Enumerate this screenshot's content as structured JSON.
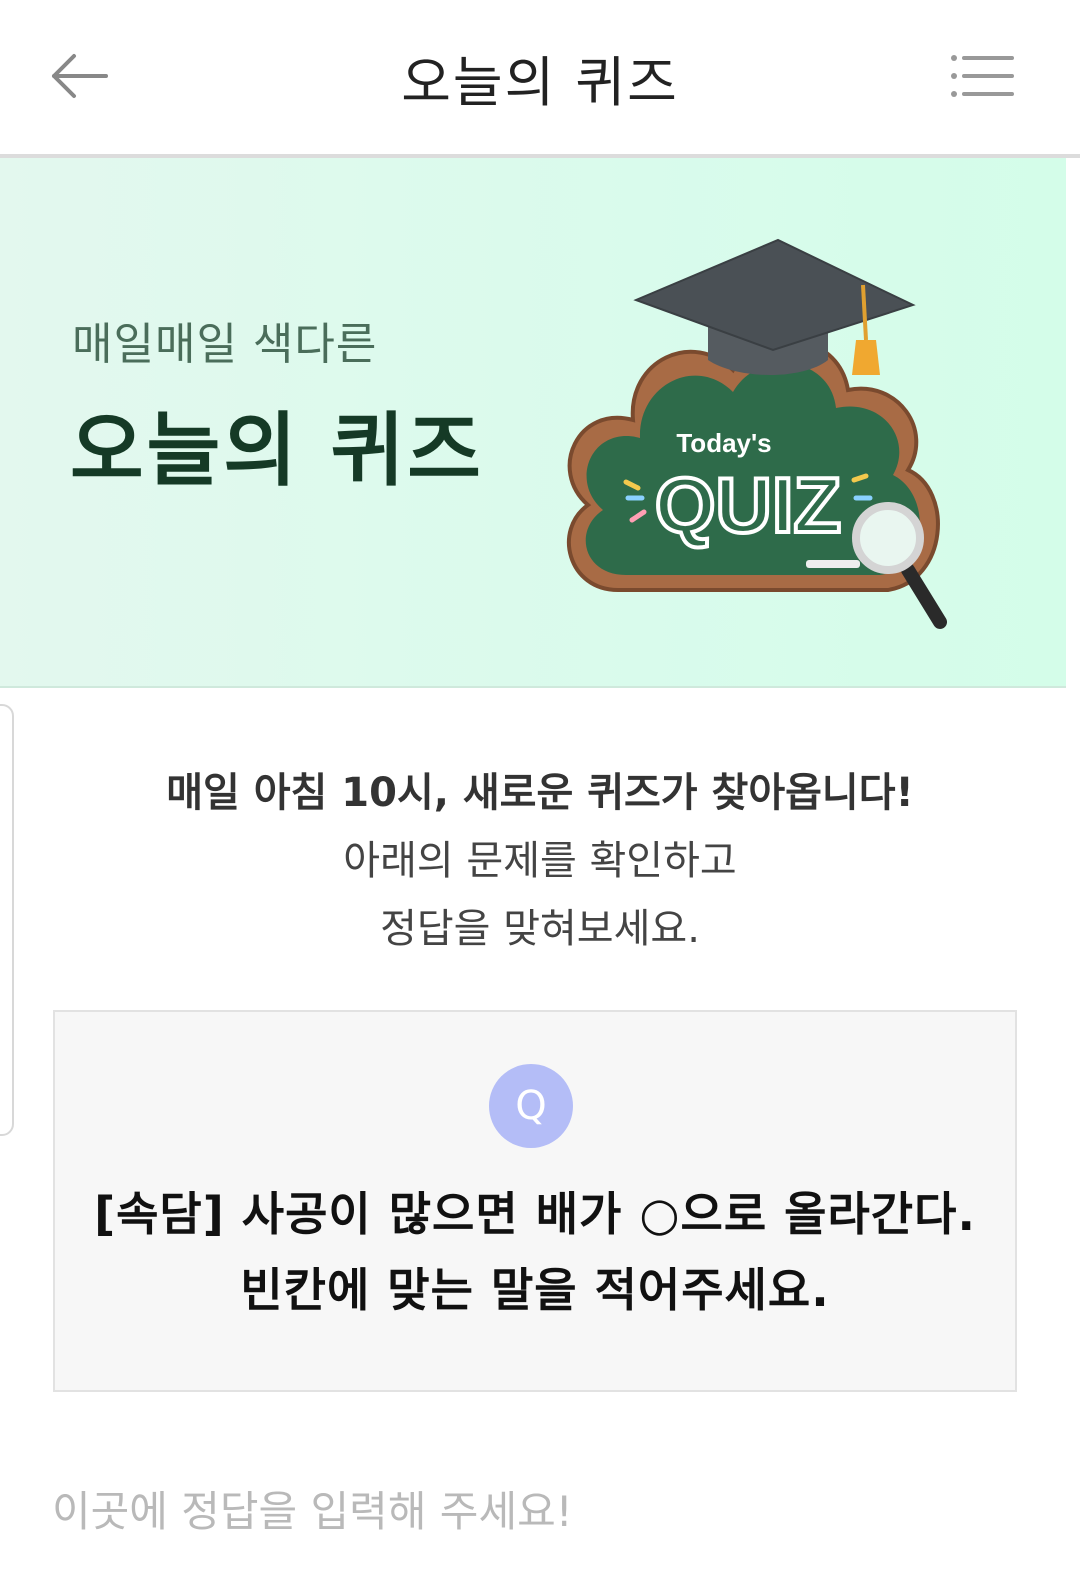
{
  "header": {
    "title": "오늘의 퀴즈",
    "back_icon": "arrow-left-icon",
    "menu_icon": "list-menu-icon"
  },
  "banner": {
    "subtitle": "매일매일 색다른",
    "title": "오늘의 퀴즈",
    "illustration": {
      "small_text": "Today's",
      "big_text": "QUIZ"
    }
  },
  "intro": {
    "line1": "매일 아침 10시, 새로운 퀴즈가 찾아옵니다!",
    "line2": "아래의 문제를 확인하고",
    "line3": "정답을 맞혀보세요."
  },
  "question": {
    "badge": "Q",
    "line1": "[속담] 사공이 많으면 배가 ○으로 올라간다.",
    "line2": "빈칸에 맞는 말을 적어주세요."
  },
  "answer": {
    "placeholder": "이곳에 정답을 입력해 주세요!",
    "value": ""
  },
  "colors": {
    "banner_bg": "#d9fbec",
    "banner_title": "#153a26",
    "badge": "#b4bdf7",
    "chalkboard": "#2e6b4a"
  }
}
